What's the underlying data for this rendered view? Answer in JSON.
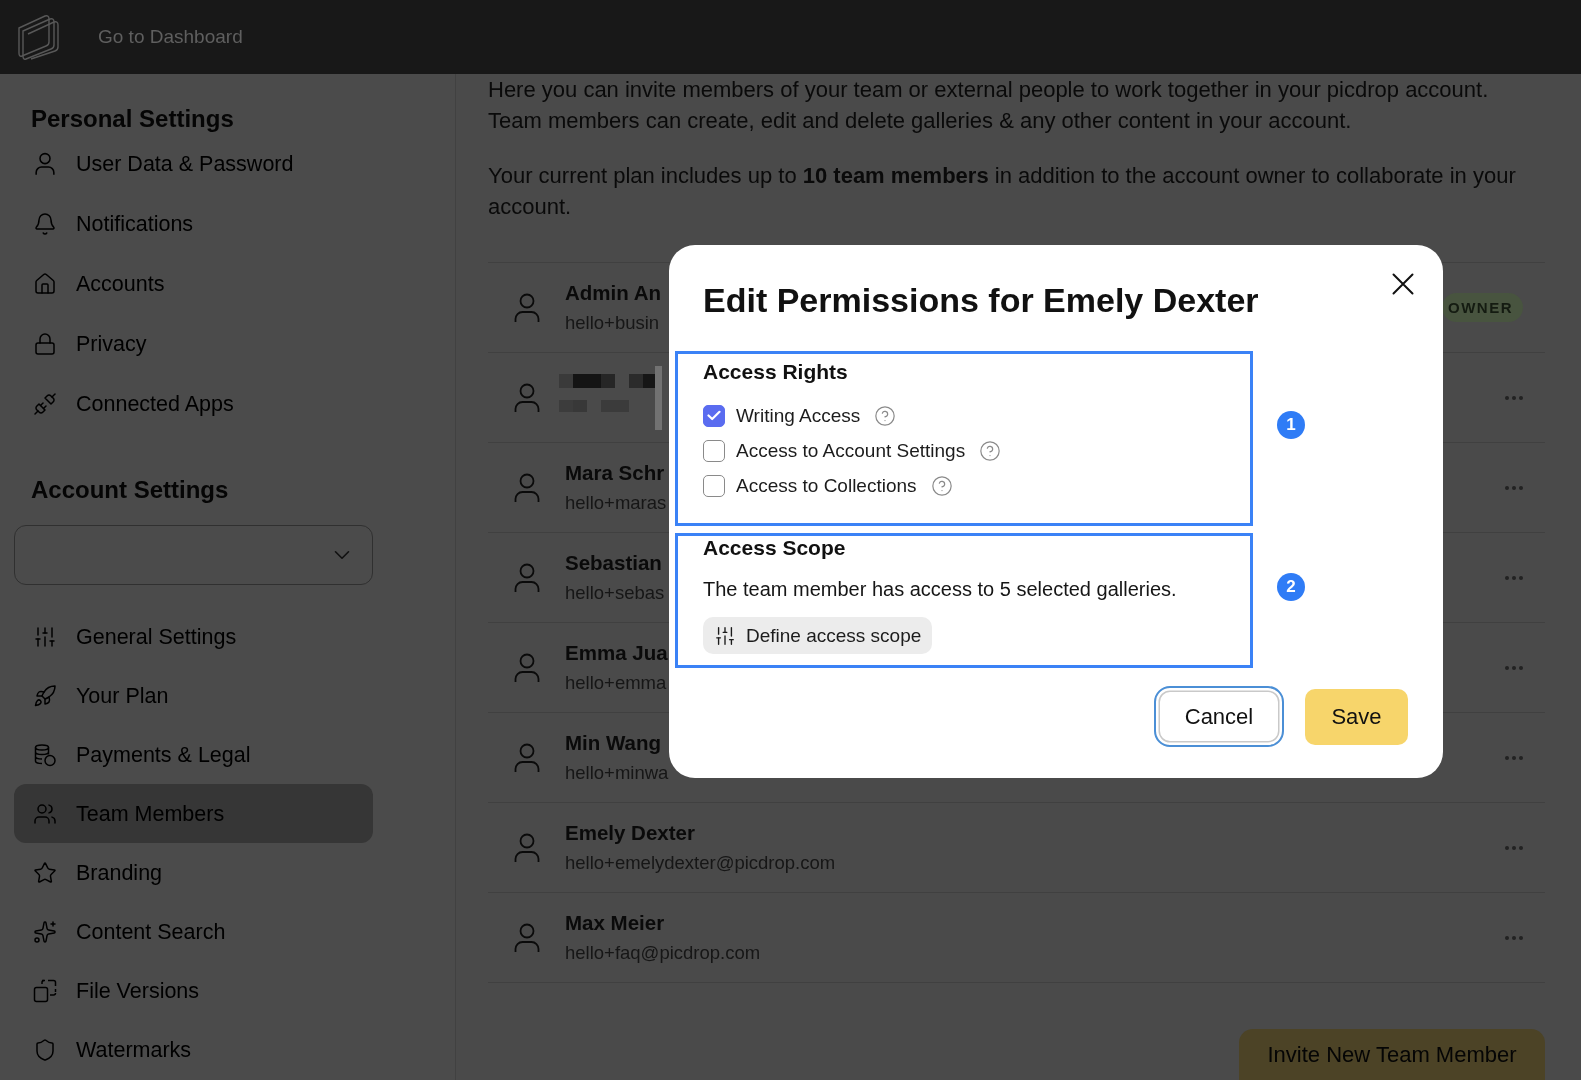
{
  "top_bar": {
    "link": "Go to Dashboard"
  },
  "sidebar": {
    "sections": [
      {
        "kind": "personal",
        "title": "Personal Settings",
        "items": [
          {
            "label": "User Data & Password",
            "selected": false
          },
          {
            "label": "Notifications",
            "selected": false
          },
          {
            "label": "Accounts",
            "selected": false
          },
          {
            "label": "Privacy",
            "selected": false
          },
          {
            "label": "Connected Apps",
            "selected": false
          }
        ]
      },
      {
        "kind": "account",
        "title": "Account Settings",
        "items": [
          {
            "label": "General Settings",
            "selected": false
          },
          {
            "label": "Your Plan",
            "selected": false
          },
          {
            "label": "Payments & Legal",
            "selected": false
          },
          {
            "label": "Team Members",
            "selected": true
          },
          {
            "label": "Branding",
            "selected": false
          },
          {
            "label": "Content Search",
            "selected": false
          },
          {
            "label": "File Versions",
            "selected": false
          },
          {
            "label": "Watermarks",
            "selected": false
          }
        ]
      }
    ]
  },
  "main": {
    "paragraphs": [
      "Here you can invite members of your team or external people to work together in your picdrop account. Team members can create, edit and delete galleries & any other content in your account.",
      "Your current plan includes up to **10 team members** in addition to the account owner to collaborate in your account."
    ],
    "members": [
      {
        "kind": "member",
        "name": "Admin An",
        "email": "hello+busin",
        "badge": "OWNER"
      },
      {
        "kind": "redacted"
      },
      {
        "kind": "member",
        "name": "Mara Schr",
        "email": "hello+maras"
      },
      {
        "kind": "member",
        "name": "Sebastian",
        "email": "hello+sebas"
      },
      {
        "kind": "member",
        "name": "Emma Jua",
        "email": "hello+emma"
      },
      {
        "kind": "member",
        "name": "Min Wang",
        "email": "hello+minwa"
      },
      {
        "kind": "member",
        "name": "Emely Dexter",
        "email": "hello+emelydexter@picdrop.com"
      },
      {
        "kind": "member",
        "name": "Max Meier",
        "email": "hello+faq@picdrop.com"
      }
    ],
    "invite_button": "Invite New Team Member"
  },
  "dialog": {
    "title": "Edit Permissions for Emely Dexter",
    "sections": [
      {
        "kind": "rights",
        "title": "Access Rights",
        "callout": "1",
        "options": [
          {
            "label": "Writing Access",
            "checked": true
          },
          {
            "label": "Access to Account Settings",
            "checked": false
          },
          {
            "label": "Access to Collections",
            "checked": false
          }
        ]
      },
      {
        "kind": "scope",
        "title": "Access Scope",
        "callout": "2",
        "text": "The team member has access to 5 selected galleries.",
        "button": "Define access scope"
      }
    ],
    "buttons": [
      {
        "label": "Cancel",
        "kind": "secondary",
        "focused": true
      },
      {
        "label": "Save",
        "kind": "primary",
        "focused": false
      }
    ]
  }
}
